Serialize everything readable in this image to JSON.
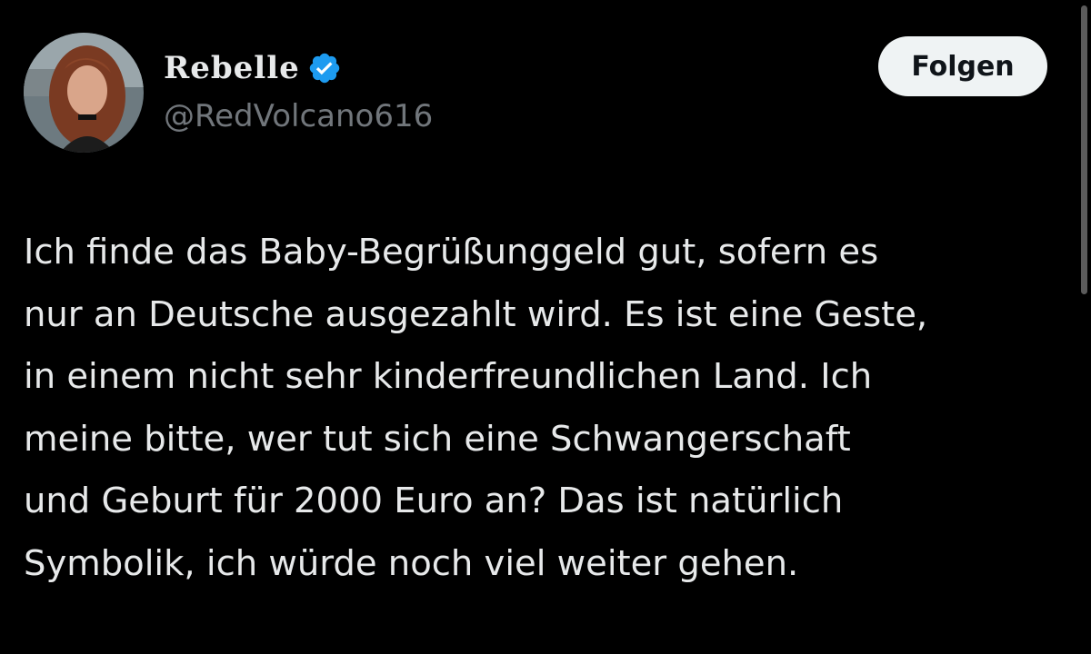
{
  "tweet": {
    "author": {
      "display_name": "Rebelle",
      "handle": "@RedVolcano616",
      "verified": true,
      "avatar_icon": "profile-photo"
    },
    "follow_label": "Folgen",
    "text": "Ich finde das Baby-Begrüßunggeld gut, sofern es\nnur an Deutsche ausgezahlt wird. Es ist eine Geste,\nin einem nicht sehr kinderfreundlichen Land. Ich\nmeine bitte, wer tut sich eine Schwangerschaft\nund Geburt für 2000 Euro an? Das ist natürlich\nSymbolik, ich würde noch viel weiter gehen."
  },
  "colors": {
    "background": "#000000",
    "text_primary": "#e7e9ea",
    "text_secondary": "#71767b",
    "verified_badge": "#1d9bf0",
    "button_bg": "#eff3f4",
    "button_text": "#0f1419"
  }
}
